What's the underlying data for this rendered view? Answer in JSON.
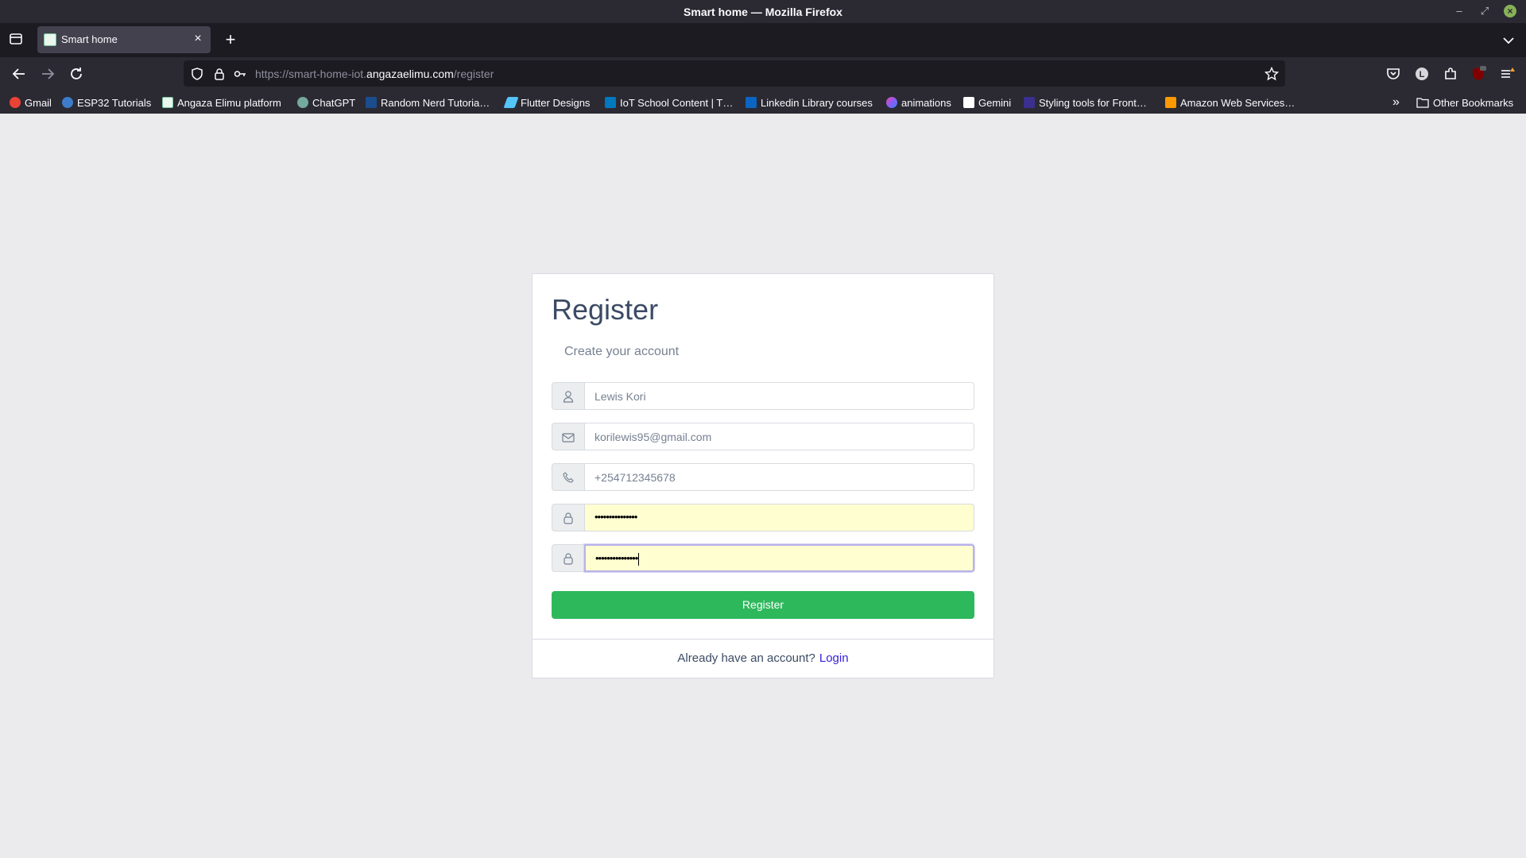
{
  "window": {
    "title": "Smart home — Mozilla Firefox",
    "controls": {
      "minimize": "–",
      "maximize": "⤢",
      "close": "×"
    }
  },
  "tabs": [
    {
      "title": "Smart home",
      "close": "×"
    }
  ],
  "new_tab": "+",
  "urlbar": {
    "prefix": "https://smart-home-iot.",
    "host": "angazaelimu.com",
    "path": "/register"
  },
  "bookmarks": {
    "items": [
      {
        "label": "Gmail",
        "icon": "google-icon",
        "color": "#ea4335"
      },
      {
        "label": "ESP32 Tutorials",
        "icon": "esp32-icon",
        "color": "#3d7cc9"
      },
      {
        "label": "Angaza Elimu platform",
        "icon": "angaza-icon",
        "color": "#7ac49a"
      },
      {
        "label": "ChatGPT",
        "icon": "chatgpt-icon",
        "color": "#74aa9c"
      },
      {
        "label": "Random Nerd Tutoria…",
        "icon": "rnt-icon",
        "color": "#1a4d8f"
      },
      {
        "label": "Flutter Designs",
        "icon": "flutter-icon",
        "color": "#54c5f8"
      },
      {
        "label": "IoT School Content | T…",
        "icon": "trello-icon",
        "color": "#0079bf"
      },
      {
        "label": "Linkedin Library courses",
        "icon": "linkedin-icon",
        "color": "#0a66c2"
      },
      {
        "label": "animations",
        "icon": "animations-icon",
        "color": "#8b5cf6"
      },
      {
        "label": "Gemini",
        "icon": "gemini-icon",
        "color": "#ffffff"
      },
      {
        "label": "Styling tools for Front…",
        "icon": "ui-icon",
        "color": "#3b2f8f"
      },
      {
        "label": "Amazon Web Services…",
        "icon": "aws-icon",
        "color": "#ff9900"
      }
    ],
    "overflow": "»",
    "other": "Other Bookmarks"
  },
  "form": {
    "title": "Register",
    "subtitle": "Create your account",
    "name_value": "Lewis Kori",
    "email_value": "korilewis95@gmail.com",
    "phone_value": "+254712345678",
    "password_value": "•••••••••••••••",
    "repeat_password_value": "•••••••••••••••",
    "submit_label": "Register",
    "footer_text": "Already have an account?",
    "login_link": "Login"
  },
  "colors": {
    "accent_green": "#2eb85c",
    "link": "#321fdb",
    "autofill": "#fffed1"
  }
}
